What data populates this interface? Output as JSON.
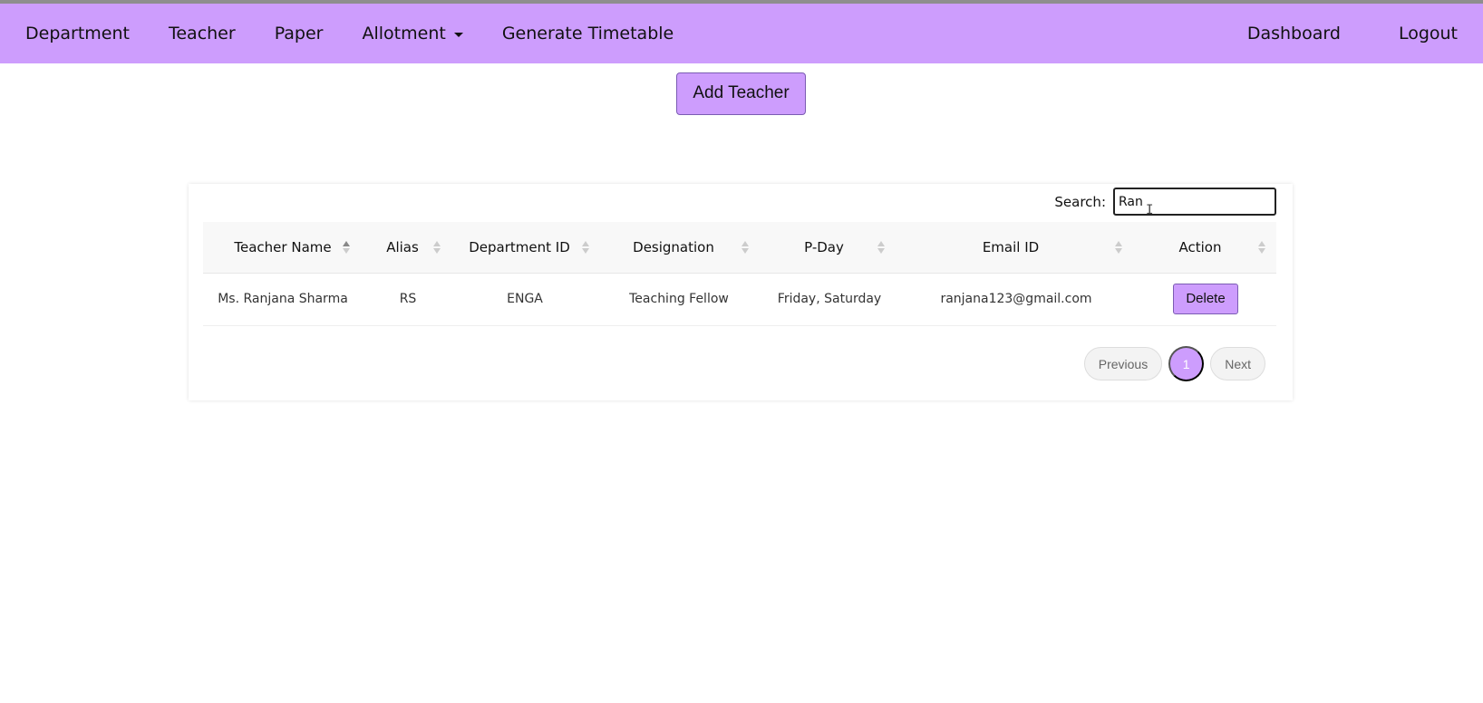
{
  "navbar": {
    "links": [
      "Department",
      "Teacher",
      "Paper",
      "Allotment",
      "Generate Timetable"
    ],
    "right_links": [
      "Dashboard",
      "Logout"
    ],
    "dropdown_icon": "caret-down-icon"
  },
  "add_button": {
    "label": "Add Teacher"
  },
  "search": {
    "label": "Search:",
    "value": "Ran"
  },
  "table": {
    "headers": [
      "Teacher Name",
      "Alias",
      "Department ID",
      "Designation",
      "P-Day",
      "Email ID",
      "Action"
    ],
    "rows": [
      {
        "name": "Ms. Ranjana Sharma",
        "alias": "RS",
        "department": "ENGA",
        "designation": "Teaching Fellow",
        "pday": "Friday, Saturday",
        "email": "ranjana123@gmail.com",
        "action": "Delete"
      }
    ]
  },
  "pagination": {
    "previous": "Previous",
    "current": "1",
    "next": "Next"
  },
  "colors": {
    "accent": "#cd9dfd",
    "accent_border": "#7b5cb3"
  }
}
